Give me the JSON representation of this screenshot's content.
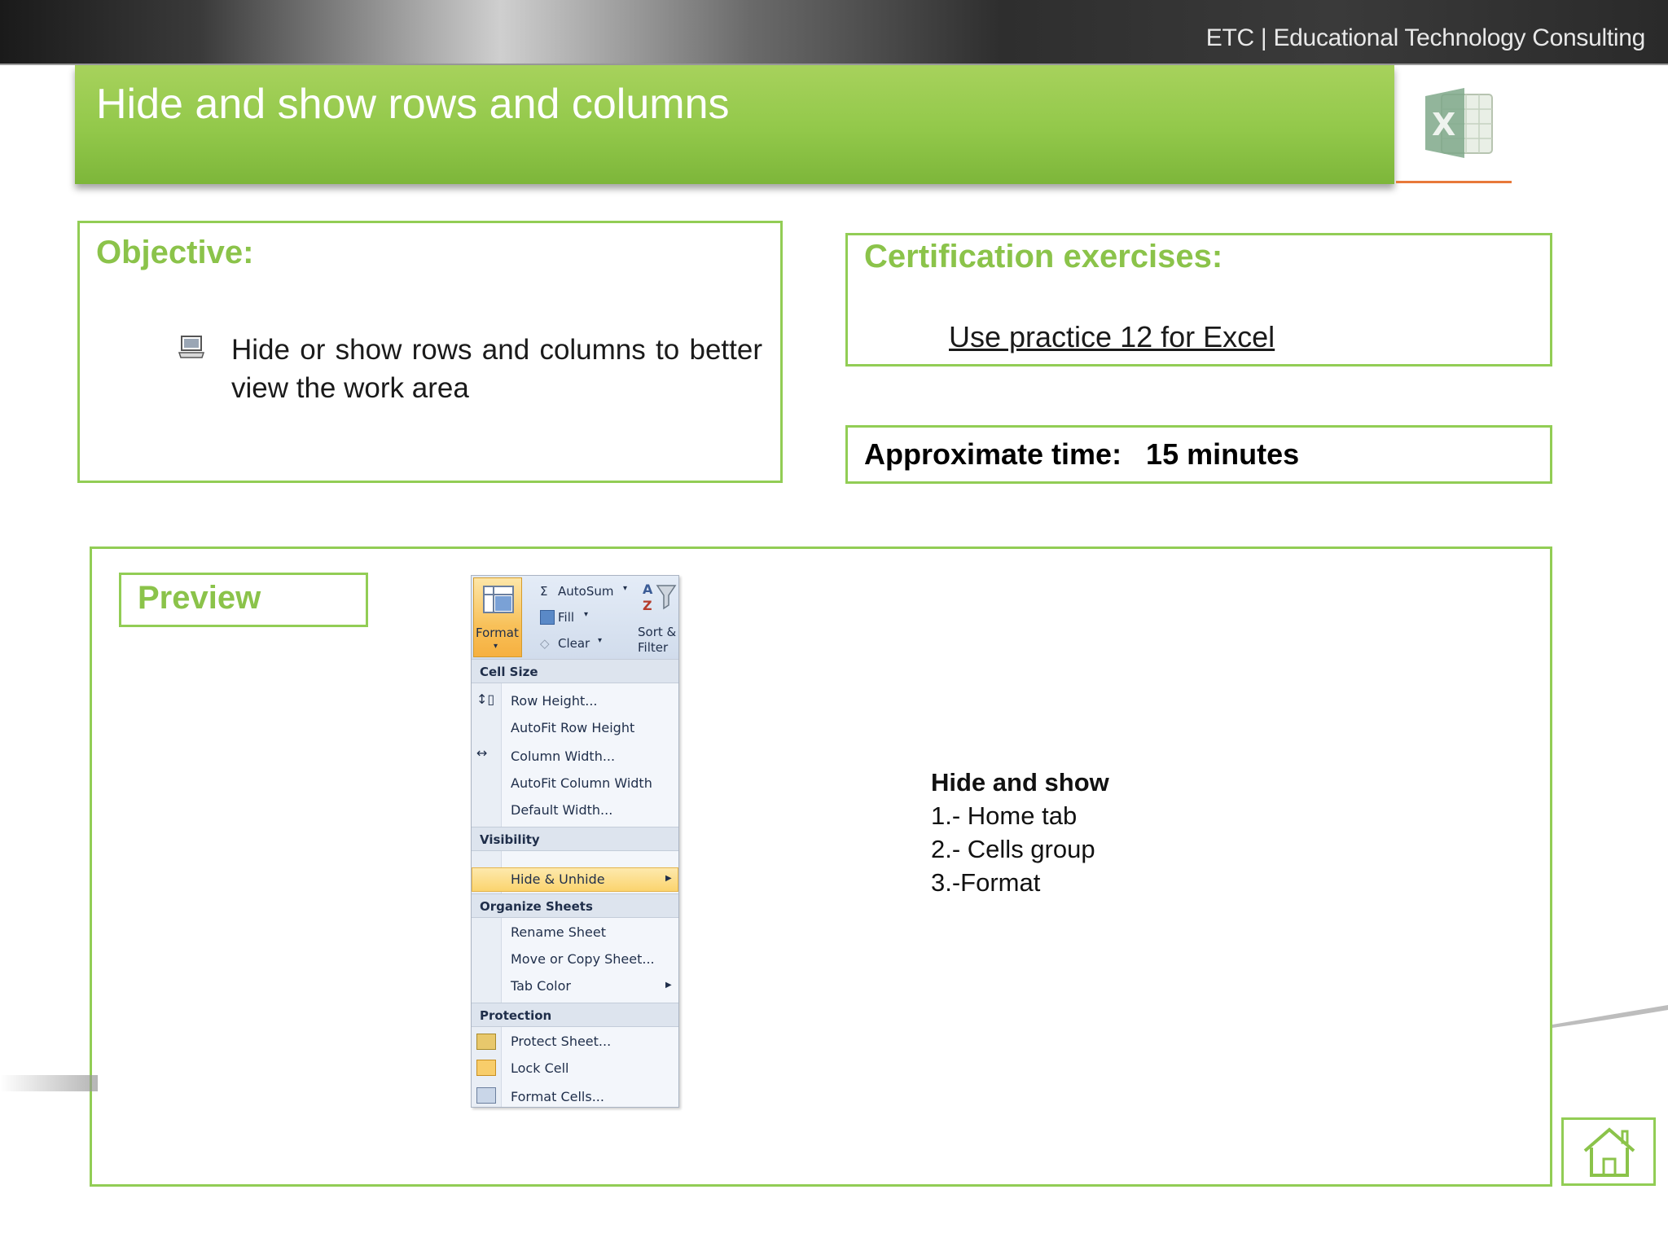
{
  "header": {
    "company": "ETC | Educational Technology Consulting"
  },
  "title": "Hide and show rows and columns",
  "objective": {
    "heading": "Objective:",
    "bullet": "Hide or show rows and columns to better view the work area"
  },
  "certification": {
    "heading": "Certification exercises:",
    "link": "Use practice 12 for Excel"
  },
  "time": {
    "text": "Approximate time:   15 minutes"
  },
  "preview": {
    "label": "Preview",
    "steps_title": "Hide and show",
    "steps": [
      "1.- Home tab",
      "2.- Cells group",
      "3.-Format"
    ]
  },
  "excel_menu": {
    "ribbon": {
      "format": "Format",
      "autosum": "AutoSum",
      "fill": "Fill",
      "clear": "Clear",
      "sort_line1": "Sort &",
      "sort_line2": "Filter"
    },
    "sections": {
      "cell_size": "Cell Size",
      "visibility": "Visibility",
      "organize": "Organize Sheets",
      "protection": "Protection"
    },
    "items": {
      "row_height": "Row Height...",
      "autofit_row": "AutoFit Row Height",
      "column_width": "Column Width...",
      "autofit_col": "AutoFit Column Width",
      "default_width": "Default Width...",
      "hide_unhide": "Hide & Unhide",
      "rename": "Rename Sheet",
      "move_copy": "Move or Copy Sheet...",
      "tab_color": "Tab Color",
      "protect": "Protect Sheet...",
      "lock": "Lock Cell",
      "format_cells": "Format Cells..."
    }
  },
  "colors": {
    "accent_green": "#92cd55",
    "heading_green": "#8bc34a",
    "logo_orange": "#e8793a"
  }
}
